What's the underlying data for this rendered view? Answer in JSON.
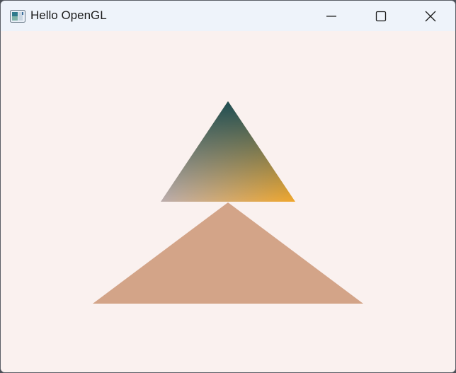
{
  "window": {
    "title": "Hello OpenGL",
    "app_icon": "opengl-app-icon",
    "controls": {
      "minimize_icon": "minimize-icon",
      "maximize_icon": "maximize-icon",
      "close_icon": "close-icon"
    }
  },
  "canvas": {
    "clear_color": "#faf1ef",
    "triangles": [
      {
        "name": "gradient-triangle",
        "vertex_colors": {
          "top": "#1e4d52",
          "bottom_left": "#bcaeae",
          "bottom_right": "#f0a72c"
        }
      },
      {
        "name": "flat-triangle",
        "fill": "#d3a488"
      }
    ]
  }
}
